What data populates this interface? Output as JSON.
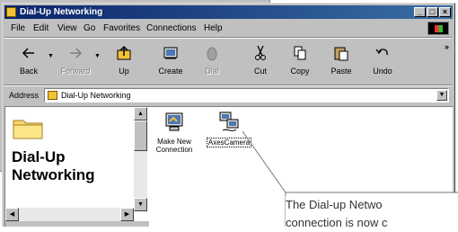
{
  "window": {
    "title": "Dial-Up Networking"
  },
  "menu": [
    "File",
    "Edit",
    "View",
    "Go",
    "Favorites",
    "Connections",
    "Help"
  ],
  "toolbar": {
    "back": "Back",
    "forward": "Forward",
    "up": "Up",
    "create": "Create",
    "dial": "Dial",
    "cut": "Cut",
    "copy": "Copy",
    "paste": "Paste",
    "undo": "Undo",
    "more": "»"
  },
  "address": {
    "label": "Address",
    "value": "Dial-Up Networking"
  },
  "left_pane": {
    "title_line1": "Dial-Up",
    "title_line2": "Networking"
  },
  "items": [
    {
      "label_line1": "Make New",
      "label_line2": "Connection"
    },
    {
      "label_line1": "AxesCamera",
      "label_line2": ""
    }
  ],
  "callout": {
    "line1": "The Dial-up Netwo",
    "line2": "connection is now c"
  }
}
